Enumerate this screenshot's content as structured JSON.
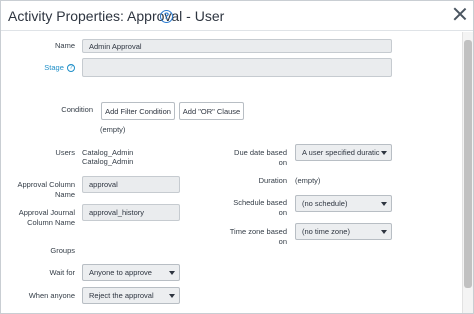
{
  "dialog": {
    "title": "Activity Properties: Approval - User",
    "help_glyph": "?"
  },
  "form": {
    "name": {
      "label": "Name",
      "value": "Admin Approval"
    },
    "stage": {
      "label": "Stage",
      "help_glyph": "?",
      "value": ""
    },
    "condition": {
      "label": "Condition",
      "add_filter_label": "Add Filter Condition",
      "add_or_label": "Add \"OR\" Clause",
      "status": "(empty)"
    },
    "users": {
      "label": "Users",
      "values": [
        "Catalog_Admin",
        "Catalog_Admin"
      ]
    },
    "approval_column": {
      "label": "Approval Column Name",
      "value": "approval"
    },
    "approval_journal": {
      "label": "Approval Journal Column Name",
      "value": "approval_history"
    },
    "groups": {
      "label": "Groups"
    },
    "wait_for": {
      "label": "Wait for",
      "value": "Anyone to approve"
    },
    "when_anyone": {
      "label": "When anyone",
      "value": "Reject the approval"
    },
    "due_date": {
      "label": "Due date based on",
      "value": "A user specified duratic"
    },
    "duration": {
      "label": "Duration",
      "value": "(empty)"
    },
    "schedule": {
      "label": "Schedule based on",
      "value": "(no schedule)"
    },
    "timezone": {
      "label": "Time zone based on",
      "value": "(no time zone)"
    }
  },
  "icons": {
    "help": "help-circle-icon",
    "close": "close-icon",
    "dropdown": "chevron-down-icon"
  },
  "colors": {
    "link": "#1f8fc8",
    "help": "#2b7bd1",
    "field_bg": "#eaecee"
  }
}
